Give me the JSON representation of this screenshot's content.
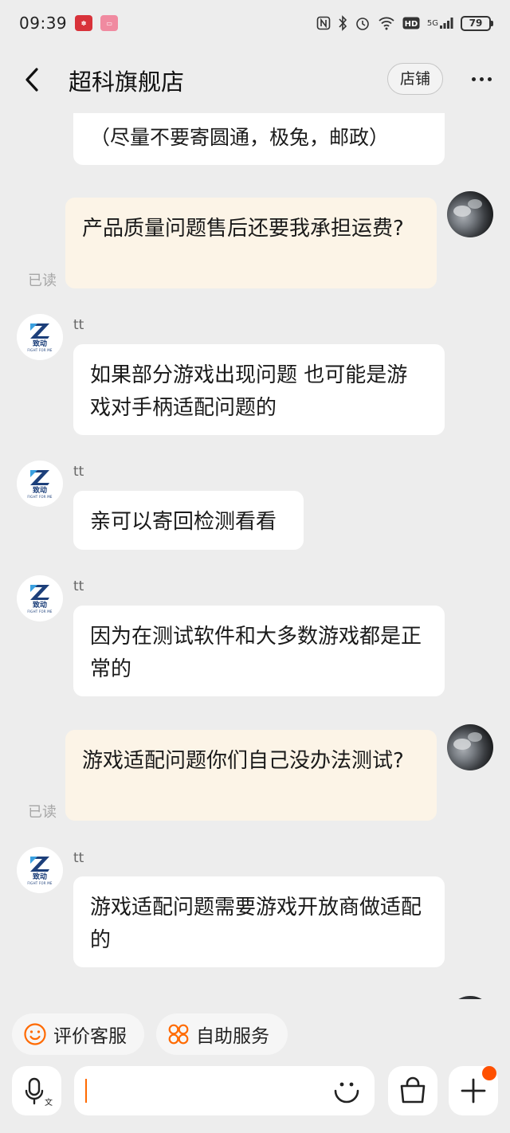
{
  "status_bar": {
    "time": "09:39",
    "battery": "79",
    "network": "5G"
  },
  "header": {
    "title": "超科旗舰店",
    "shop_button": "店铺"
  },
  "messages": [
    {
      "side": "left",
      "text": "（尽量不要寄圆通，极兔，邮政）"
    },
    {
      "side": "right",
      "text": "产品质量问题售后还要我承担运费?",
      "read": "已读"
    },
    {
      "side": "left",
      "sender": "tt",
      "text": "如果部分游戏出现问题 也可能是游戏对手柄适配问题的"
    },
    {
      "side": "left",
      "sender": "tt",
      "text": "亲可以寄回检测看看"
    },
    {
      "side": "left",
      "sender": "tt",
      "text": "因为在测试软件和大多数游戏都是正常的"
    },
    {
      "side": "right",
      "text": "游戏适配问题你们自己没办法测试?",
      "read": "已读"
    },
    {
      "side": "left",
      "sender": "tt",
      "text": "游戏适配问题需要游戏开放商做适配的"
    }
  ],
  "shop_avatar": {
    "cn": "致动",
    "en": "FIGHT FOR ME"
  },
  "quick_actions": [
    {
      "label": "评价客服",
      "icon": "smile-icon"
    },
    {
      "label": "自助服务",
      "icon": "grid-icon"
    }
  ],
  "input": {
    "value": ""
  },
  "colors": {
    "accent": "#ff6a00",
    "right_bubble": "#fcf4e7",
    "left_bubble": "#ffffff",
    "background": "#ededed",
    "badge": "#ff5000"
  }
}
